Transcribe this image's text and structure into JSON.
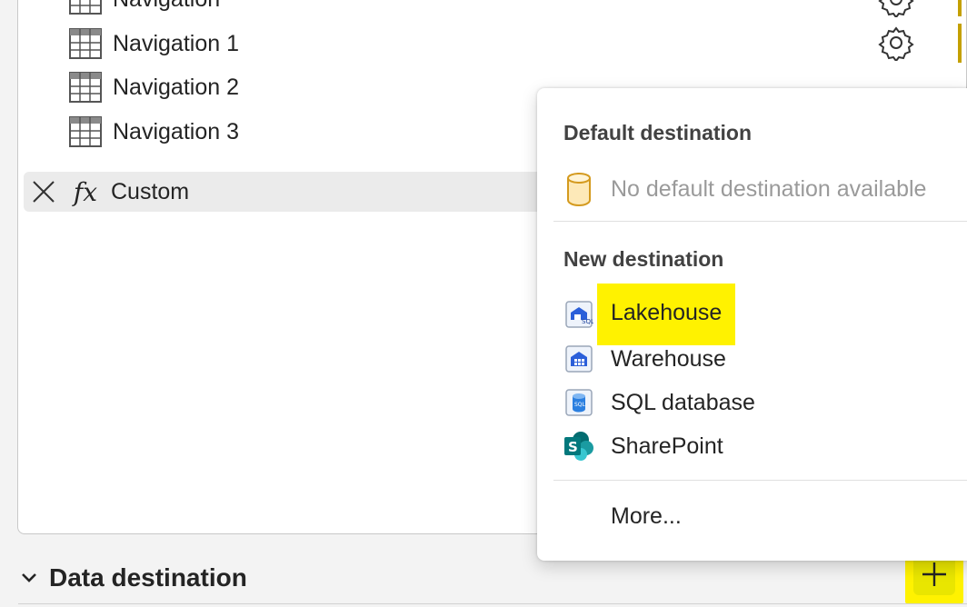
{
  "steps": {
    "items": [
      {
        "label": "Navigation"
      },
      {
        "label": "Navigation 1"
      },
      {
        "label": "Navigation 2"
      },
      {
        "label": "Navigation 3"
      }
    ],
    "selected": {
      "label": "Custom",
      "fx": "fx"
    }
  },
  "section": {
    "title": "Data destination"
  },
  "menu": {
    "default_title": "Default destination",
    "default_item": "No default destination available",
    "new_title": "New destination",
    "items": [
      {
        "label": "Lakehouse",
        "icon": "lakehouse-icon"
      },
      {
        "label": "Warehouse",
        "icon": "warehouse-icon"
      },
      {
        "label": "SQL database",
        "icon": "sql-database-icon"
      },
      {
        "label": "SharePoint",
        "icon": "sharepoint-icon"
      }
    ],
    "more": "More..."
  },
  "colors": {
    "highlight": "#fff200",
    "warning": "#c4a000",
    "sharepoint": "#03787c",
    "fabric_blue": "#2b5fd9"
  }
}
